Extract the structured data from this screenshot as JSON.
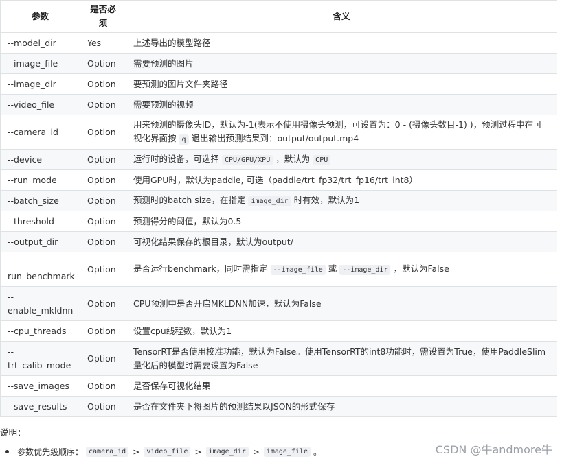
{
  "table": {
    "headers": [
      "参数",
      "是否必须",
      "含义"
    ],
    "rows": [
      {
        "param": "--model_dir",
        "required": "Yes",
        "meaning": [
          "上述导出的模型路径"
        ]
      },
      {
        "param": "--image_file",
        "required": "Option",
        "meaning": [
          "需要预测的图片"
        ]
      },
      {
        "param": "--image_dir",
        "required": "Option",
        "meaning": [
          "要预测的图片文件夹路径"
        ]
      },
      {
        "param": "--video_file",
        "required": "Option",
        "meaning": [
          "需要预测的视频"
        ]
      },
      {
        "param": "--camera_id",
        "required": "Option",
        "meaning": [
          "用来预测的摄像头ID，默认为-1(表示不使用摄像头预测，可设置为：0 - (摄像头数目-1) )，预测过程中在可视化界面按 ",
          "q",
          " 退出输出预测结果到：output/output.mp4"
        ]
      },
      {
        "param": "--device",
        "required": "Option",
        "meaning": [
          "运行时的设备，可选择 ",
          "CPU/GPU/XPU",
          " ，默认为 ",
          "CPU"
        ]
      },
      {
        "param": "--run_mode",
        "required": "Option",
        "meaning": [
          "使用GPU时，默认为paddle, 可选（paddle/trt_fp32/trt_fp16/trt_int8）"
        ]
      },
      {
        "param": "--batch_size",
        "required": "Option",
        "meaning": [
          "预测时的batch size，在指定 ",
          "image_dir",
          " 时有效，默认为1"
        ]
      },
      {
        "param": "--threshold",
        "required": "Option",
        "meaning": [
          "预测得分的阈值，默认为0.5"
        ]
      },
      {
        "param": "--output_dir",
        "required": "Option",
        "meaning": [
          "可视化结果保存的根目录，默认为output/"
        ]
      },
      {
        "param": "--run_benchmark",
        "required": "Option",
        "meaning": [
          "是否运行benchmark，同时需指定 ",
          "--image_file",
          " 或 ",
          "--image_dir",
          " ，默认为False"
        ]
      },
      {
        "param": "--enable_mkldnn",
        "required": "Option",
        "meaning": [
          "CPU预测中是否开启MKLDNN加速，默认为False"
        ]
      },
      {
        "param": "--cpu_threads",
        "required": "Option",
        "meaning": [
          "设置cpu线程数，默认为1"
        ]
      },
      {
        "param": "--trt_calib_mode",
        "required": "Option",
        "meaning": [
          "TensorRT是否使用校准功能，默认为False。使用TensorRT的int8功能时，需设置为True，使用PaddleSlim量化后的模型时需要设置为False"
        ]
      },
      {
        "param": "--save_images",
        "required": "Option",
        "meaning": [
          "是否保存可视化结果"
        ]
      },
      {
        "param": "--save_results",
        "required": "Option",
        "meaning": [
          "是否在文件夹下将图片的预测结果以JSON的形式保存"
        ]
      }
    ]
  },
  "note": {
    "title": "说明：",
    "priority_label": "参数优先级顺序：",
    "priority_items": [
      "camera_id",
      "video_file",
      "image_dir",
      "image_file"
    ],
    "separator": ">",
    "end": "。"
  },
  "watermark": "CSDN @牛andmore牛"
}
